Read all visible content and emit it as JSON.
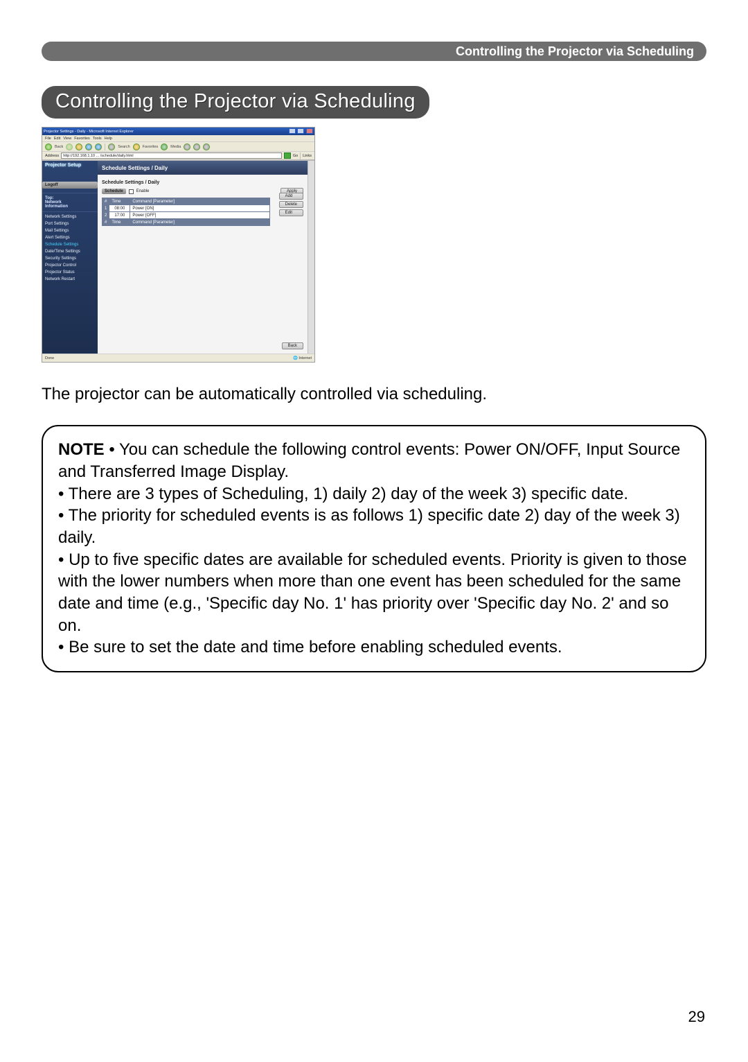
{
  "header_bar": "Controlling the Projector via Scheduling",
  "main_heading": "Controlling the Projector via Scheduling",
  "page_number": "29",
  "body_paragraph": "The projector can be automatically controlled via scheduling.",
  "note": {
    "label": "NOTE",
    "lines": [
      "• You can schedule the following control events: Power ON/OFF, Input Source and Transferred Image Display.",
      "• There are 3 types of Scheduling, 1) daily 2) day of the week 3) specific date.",
      "• The priority for scheduled events is as follows 1) specific date 2) day of the week 3) daily.",
      "• Up to five specific dates are available for scheduled events. Priority is given to those with the lower numbers when more than one event has been scheduled for the same date and time (e.g., 'Specific day No. 1' has priority over 'Specific day No. 2' and so on.",
      "• Be sure to set the date and time before enabling scheduled events."
    ]
  },
  "ie": {
    "title": "Projector Settings - Daily - Microsoft Internet Explorer",
    "menu": [
      "File",
      "Edit",
      "View",
      "Favorites",
      "Tools",
      "Help"
    ],
    "toolbar": {
      "back": "Back",
      "search": "Search",
      "favorites": "Favorites",
      "media": "Media"
    },
    "address_label": "Address",
    "address_url": "http://192.168.1.10 ... /schedule/daily.html",
    "go": "Go",
    "links": "Links",
    "status_left": "Done",
    "status_right": "Internet",
    "sidebar": {
      "brand": "Projector Setup",
      "logoff": "Logoff",
      "items": [
        {
          "label": "Top:\nNetwork\nInformation",
          "kind": "bold"
        },
        {
          "label": "Network Settings",
          "kind": "link"
        },
        {
          "label": "Port Settings",
          "kind": "link"
        },
        {
          "label": "Mail Settings",
          "kind": "link"
        },
        {
          "label": "Alert Settings",
          "kind": "link"
        },
        {
          "label": "Schedule Settings",
          "kind": "current"
        },
        {
          "label": "Date/Time Settings",
          "kind": "link"
        },
        {
          "label": "Security Settings",
          "kind": "link"
        },
        {
          "label": "Projector Control",
          "kind": "link"
        },
        {
          "label": "Projector Status",
          "kind": "link"
        },
        {
          "label": "Network Restart",
          "kind": "link"
        }
      ]
    },
    "content": {
      "title": "Schedule Settings / Daily",
      "crumb": "Schedule Settings / Daily",
      "schedule_pill": "Schedule",
      "enable_label": "Enable",
      "btn_apply": "Apply",
      "btn_add": "Add",
      "btn_delete": "Delete",
      "btn_edit": "Edit",
      "btn_back": "Back",
      "table": {
        "headers": [
          "#",
          "Time",
          "Command [Parameter]"
        ],
        "rows": [
          {
            "mark": "1",
            "time": "08:00",
            "cmd": "Power [ON]"
          },
          {
            "mark": "2",
            "time": "17:00",
            "cmd": "Power [OFF]"
          }
        ],
        "footer_headers": [
          "#",
          "Time",
          "Command [Parameter]"
        ]
      }
    }
  }
}
